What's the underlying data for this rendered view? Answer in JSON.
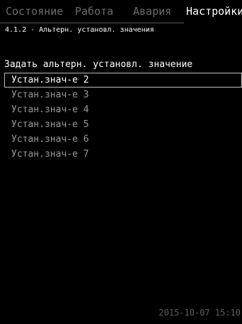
{
  "tabs": [
    {
      "label": "Состояние",
      "active": false
    },
    {
      "label": "Работа",
      "active": false
    },
    {
      "label": "Авария",
      "active": false
    },
    {
      "label": "Настройки",
      "active": true
    }
  ],
  "breadcrumb": "4.1.2 - Альтерн. установл. значения",
  "section_title": "Задать альтерн. установл. значение",
  "items": [
    {
      "label": "Устан.знач-е 2",
      "selected": true
    },
    {
      "label": "Устан.знач-е 3",
      "selected": false
    },
    {
      "label": "Устан.знач-е 4",
      "selected": false
    },
    {
      "label": "Устан.знач-е 5",
      "selected": false
    },
    {
      "label": "Устан.знач-е 6",
      "selected": false
    },
    {
      "label": "Устан.знач-е 7",
      "selected": false
    }
  ],
  "datetime": "2015-10-07 15:10",
  "colors": {
    "background": "#000000",
    "active_text": "#ffffff",
    "inactive_tab": "#6c6c6c",
    "list_item": "#9a9a9a",
    "selection_border": "#bdbdbd",
    "datetime": "#5e5e5e"
  }
}
